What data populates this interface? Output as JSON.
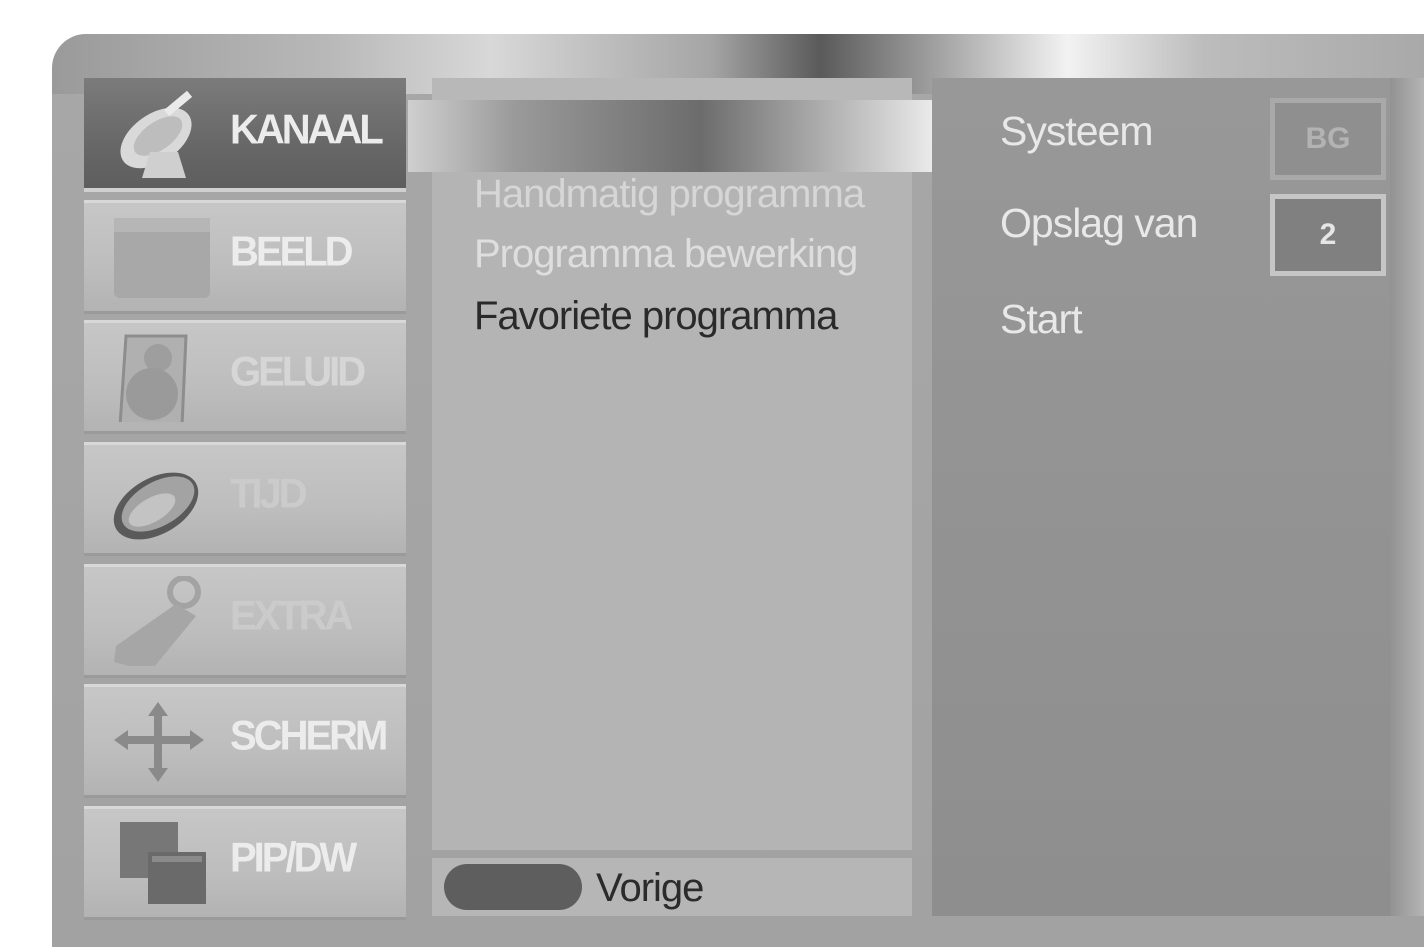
{
  "sidebar": {
    "items": [
      {
        "label": "KANAAL",
        "icon": "satellite-dish-icon",
        "active": true
      },
      {
        "label": "BEELD",
        "icon": "picture-icon"
      },
      {
        "label": "GELUID",
        "icon": "speaker-icon"
      },
      {
        "label": "TIJD",
        "icon": "clock-icon"
      },
      {
        "label": "EXTRA",
        "icon": "key-icon"
      },
      {
        "label": "SCHERM",
        "icon": "move-arrows-icon"
      },
      {
        "label": "PIP/DW",
        "icon": "pip-icon"
      }
    ]
  },
  "submenu": {
    "items": [
      {
        "label": "Handmatig programma"
      },
      {
        "label": "Programma bewerking"
      },
      {
        "label": "Favoriete programma"
      }
    ],
    "footer": {
      "label": "Vorige"
    }
  },
  "settings": {
    "system": {
      "label": "Systeem",
      "value": "BG"
    },
    "store_from": {
      "label": "Opslag van",
      "value": "2"
    },
    "start": {
      "label": "Start"
    }
  },
  "colors": {
    "active_item_bg": "#676767",
    "panel_bg": "#b4b4b4",
    "right_panel_bg": "#909090",
    "text_light": "#e8e8e8"
  }
}
